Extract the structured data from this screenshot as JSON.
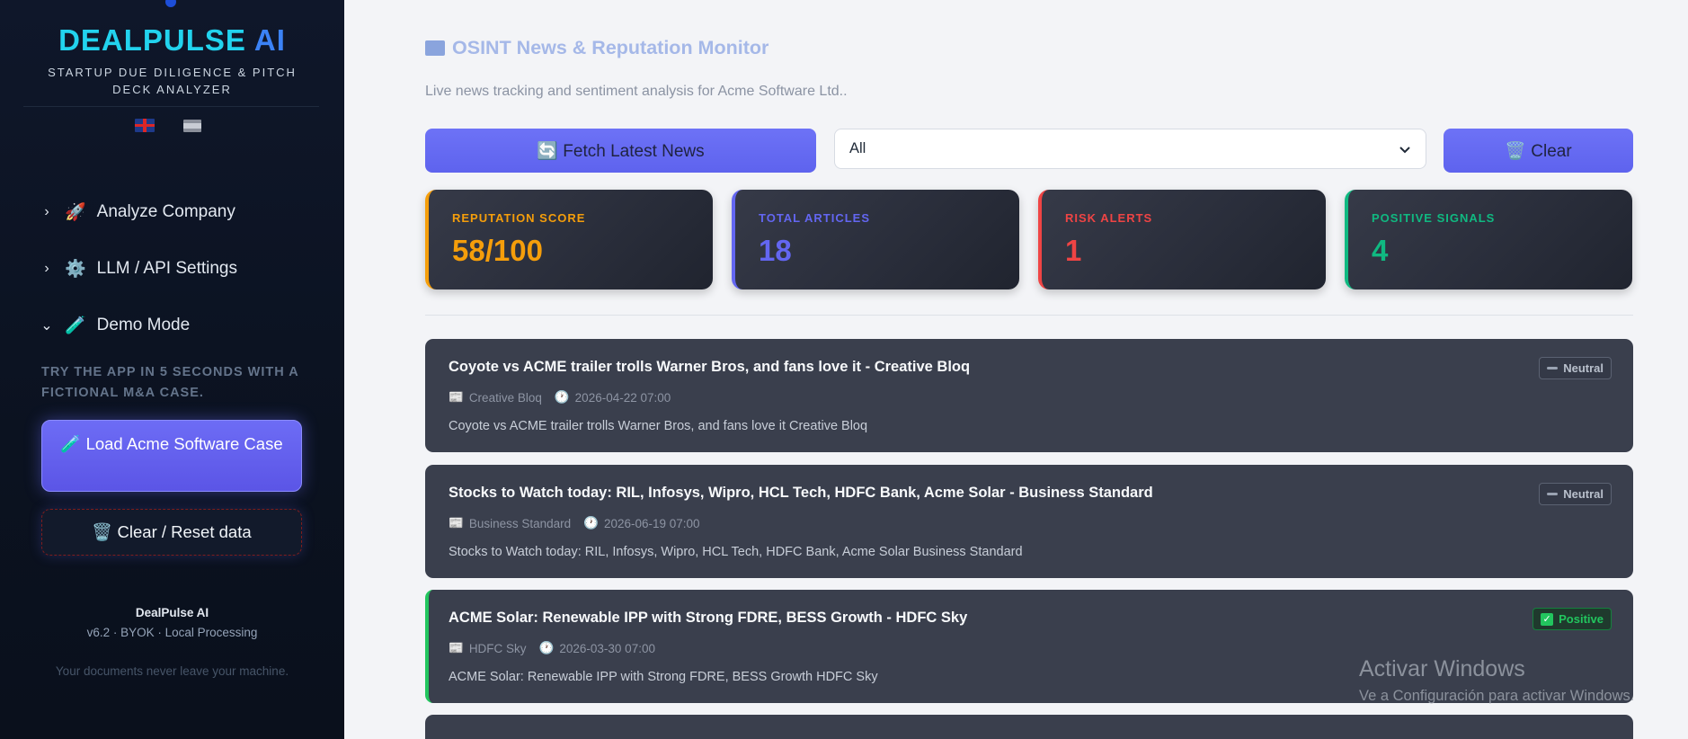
{
  "sidebar": {
    "brand_main": "DEALPULSE",
    "brand_ai": " AI",
    "tagline": "STARTUP DUE DILIGENCE & PITCH DECK ANALYZER",
    "nav": [
      {
        "icon": "🚀",
        "label": "Analyze Company",
        "expanded": false
      },
      {
        "icon": "⚙️",
        "label": "LLM / API Settings",
        "expanded": false
      },
      {
        "icon": "🧪",
        "label": "Demo Mode",
        "expanded": true
      }
    ],
    "demo_text": "TRY THE APP IN 5 SECONDS WITH A FICTIONAL M&A CASE.",
    "load_button": "🧪 Load Acme Software Case",
    "reset_button": "🗑️ Clear / Reset data",
    "footer_name": "DealPulse AI",
    "footer_version": "v6.2 · BYOK · Local Processing",
    "footer_note": "Your documents never leave your machine."
  },
  "main": {
    "title": "OSINT News & Reputation Monitor",
    "subtitle": "Live news tracking and sentiment analysis for Acme Software Ltd..",
    "fetch_button": "🔄 Fetch Latest News",
    "filter_value": "All",
    "clear_button": "🗑️ Clear",
    "metrics": [
      {
        "label": "REPUTATION SCORE",
        "value": "58/100",
        "color": "#f59e0b"
      },
      {
        "label": "TOTAL ARTICLES",
        "value": "18",
        "color": "#6366f1"
      },
      {
        "label": "RISK ALERTS",
        "value": "1",
        "color": "#ef4444"
      },
      {
        "label": "POSITIVE SIGNALS",
        "value": "4",
        "color": "#10b981"
      }
    ],
    "articles": [
      {
        "title": "Coyote vs ACME trailer trolls Warner Bros, and fans love it - Creative Bloq",
        "source": "Creative Bloq",
        "date": "2026-04-22 07:00",
        "desc": "Coyote vs ACME trailer trolls Warner Bros, and fans love it  Creative Bloq",
        "sentiment": "Neutral"
      },
      {
        "title": "Stocks to Watch today: RIL, Infosys, Wipro, HCL Tech, HDFC Bank, Acme Solar - Business Standard",
        "source": "Business Standard",
        "date": "2026-06-19 07:00",
        "desc": "Stocks to Watch today: RIL, Infosys, Wipro, HCL Tech, HDFC Bank, Acme Solar  Business Standard",
        "sentiment": "Neutral"
      },
      {
        "title": "ACME Solar: Renewable IPP with Strong FDRE, BESS Growth - HDFC Sky",
        "source": "HDFC Sky",
        "date": "2026-03-30 07:00",
        "desc": "ACME Solar: Renewable IPP with Strong FDRE, BESS Growth  HDFC Sky",
        "sentiment": "Positive"
      }
    ]
  },
  "watermark": {
    "line1": "Activar Windows",
    "line2": "Ve a Configuración para activar Windows."
  }
}
